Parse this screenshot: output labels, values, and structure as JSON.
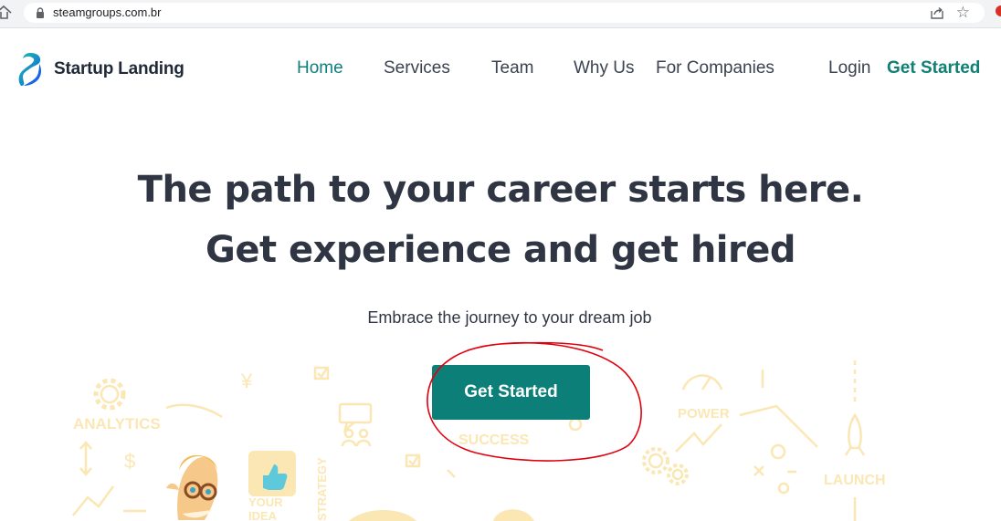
{
  "browser": {
    "url": "steamgroups.com.br",
    "icons": [
      "home-icon",
      "lock-icon",
      "share-icon",
      "star-icon"
    ]
  },
  "header": {
    "logo_text": "Startup Landing",
    "nav": [
      {
        "label": "Home",
        "active": true
      },
      {
        "label": "Services",
        "active": false
      },
      {
        "label": "Team",
        "active": false
      },
      {
        "label": "Why Us",
        "active": false
      },
      {
        "label": "For Companies",
        "active": false
      },
      {
        "label": "Login",
        "active": false
      }
    ],
    "cta_label": "Get Started"
  },
  "hero": {
    "headline_line1": "The path to your career starts here.",
    "headline_line2": "Get experience and get hired",
    "subtitle": "Embrace the journey to your dream job",
    "cta_label": "Get Started"
  },
  "illustration": {
    "words": {
      "analytics": "ANALYTICS",
      "success": "SUCCESS",
      "power": "POWER",
      "launch": "LAUNCH",
      "strategy": "STRATEGY",
      "your_idea_1": "YOUR",
      "your_idea_2": "IDEA"
    }
  },
  "colors": {
    "brand_teal": "#0d7f79",
    "nav_active": "#0f7f7a",
    "headline": "#2f3542",
    "illustration_tint": "#fbe7b4",
    "annotation_red": "#e0000e"
  }
}
